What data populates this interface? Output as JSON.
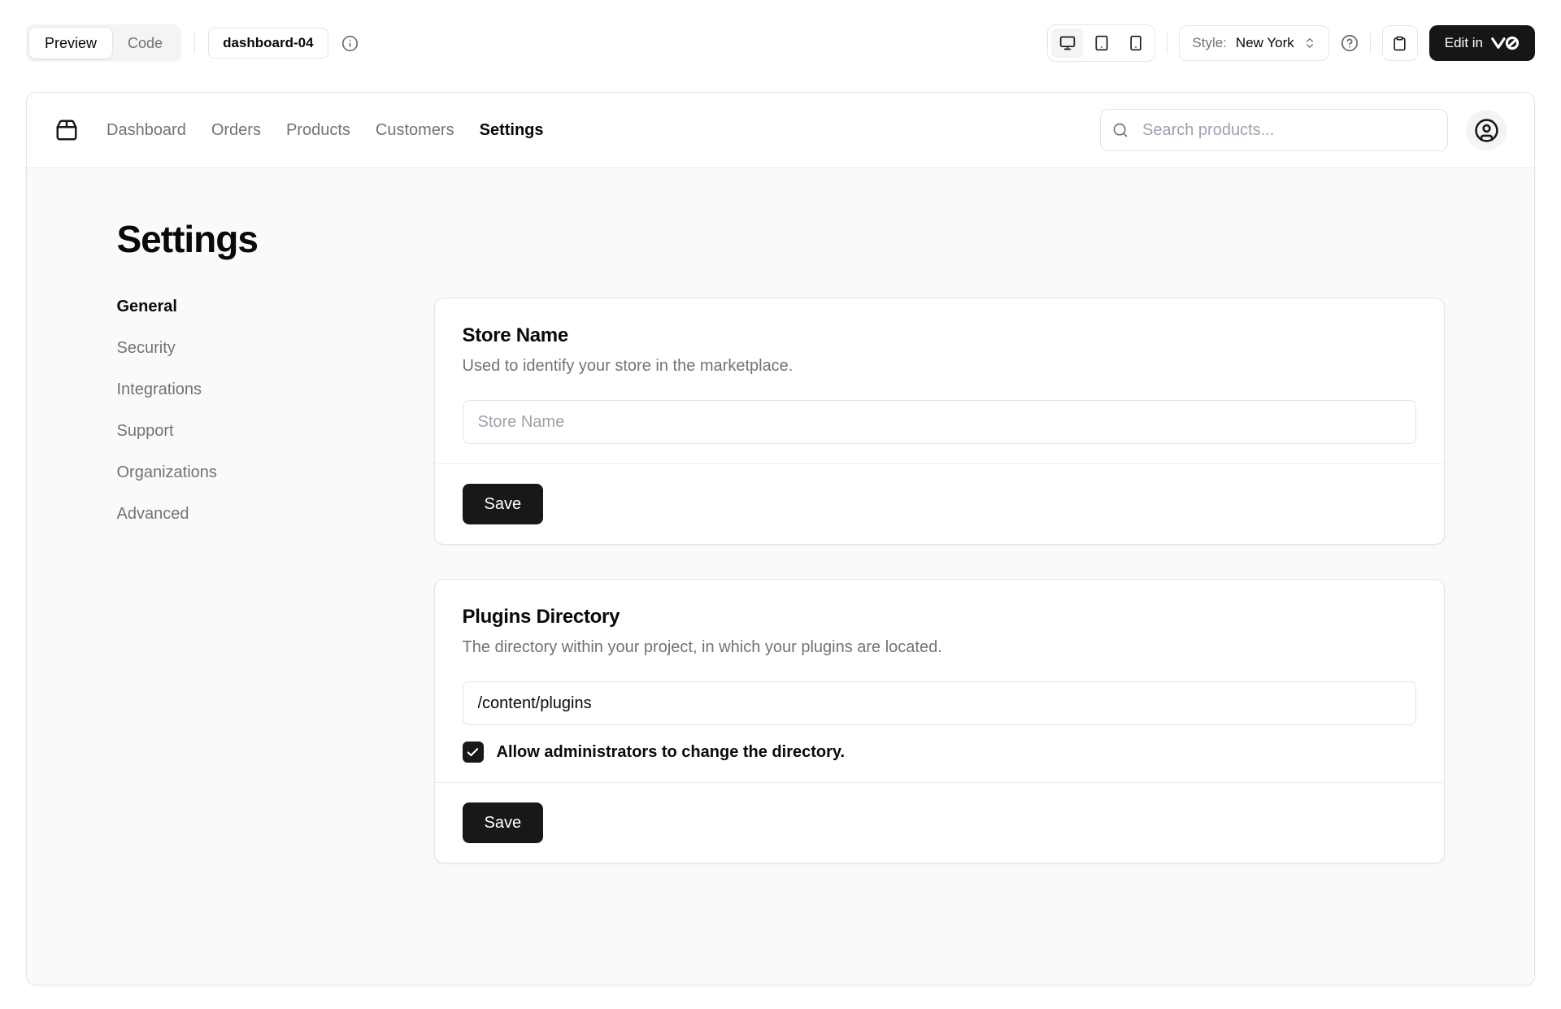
{
  "toolbar": {
    "tabs": {
      "preview": "Preview",
      "code": "Code"
    },
    "block_badge": "dashboard-04",
    "style": {
      "label": "Style:",
      "value": "New York"
    },
    "edit_button": {
      "label": "Edit in",
      "logo": "v0"
    }
  },
  "app": {
    "nav": {
      "items": [
        {
          "label": "Dashboard",
          "active": false
        },
        {
          "label": "Orders",
          "active": false
        },
        {
          "label": "Products",
          "active": false
        },
        {
          "label": "Customers",
          "active": false
        },
        {
          "label": "Settings",
          "active": true
        }
      ]
    },
    "search": {
      "placeholder": "Search products..."
    },
    "page_title": "Settings",
    "sidebar": {
      "items": [
        {
          "label": "General",
          "active": true
        },
        {
          "label": "Security",
          "active": false
        },
        {
          "label": "Integrations",
          "active": false
        },
        {
          "label": "Support",
          "active": false
        },
        {
          "label": "Organizations",
          "active": false
        },
        {
          "label": "Advanced",
          "active": false
        }
      ]
    },
    "cards": [
      {
        "title": "Store Name",
        "description": "Used to identify your store in the marketplace.",
        "input": {
          "placeholder": "Store Name",
          "value": ""
        },
        "footer": {
          "save": "Save"
        }
      },
      {
        "title": "Plugins Directory",
        "description": "The directory within your project, in which your plugins are located.",
        "input": {
          "value": "/content/plugins"
        },
        "checkbox": {
          "checked": true,
          "label": "Allow administrators to change the directory."
        },
        "footer": {
          "save": "Save"
        }
      }
    ]
  },
  "colors": {
    "accent": "#18181b",
    "muted_text": "#737373",
    "border": "#e4e4e7",
    "content_bg": "#fafafa",
    "pill_bg": "#f4f4f5"
  }
}
